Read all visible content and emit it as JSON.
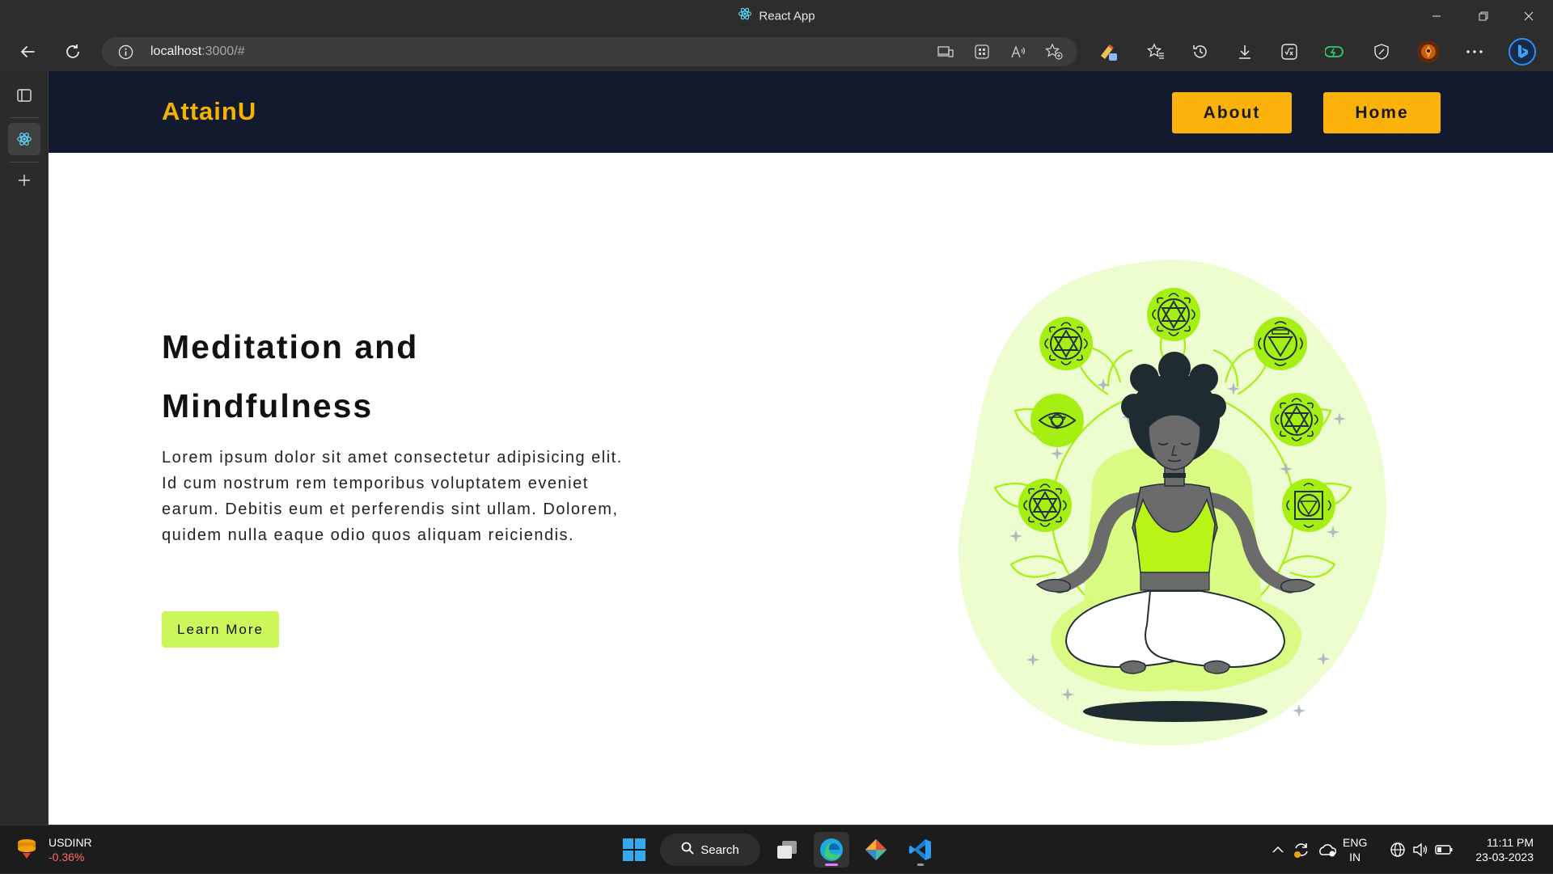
{
  "window": {
    "tab_title": "React App"
  },
  "toolbar": {
    "url_host": "localhost",
    "url_rest": ":3000/#"
  },
  "page": {
    "brand": "AttainU",
    "nav": {
      "about": "About",
      "home": "Home"
    },
    "hero": {
      "title": "Meditation and Mindfulness",
      "body": "Lorem ipsum dolor sit amet consectetur adipisicing elit. Id cum nostrum rem temporibus voluptatem eveniet earum. Debitis eum et perferendis sint ullam. Dolorem, quidem nulla eaque odio quos aliquam reiciendis.",
      "cta": "Learn More"
    }
  },
  "taskbar": {
    "widget_symbol": "USDINR",
    "widget_change": "-0.36%",
    "search_label": "Search",
    "lang_top": "ENG",
    "lang_bottom": "IN",
    "time": "11:11 PM",
    "date": "23-03-2023"
  },
  "colors": {
    "nav_bg": "#131a2e",
    "brand": "#f5b300",
    "nav_button": "#fbb20b",
    "cta": "#ccf75a",
    "chakra_green": "#a5f012",
    "blob": "#eefdcf"
  }
}
